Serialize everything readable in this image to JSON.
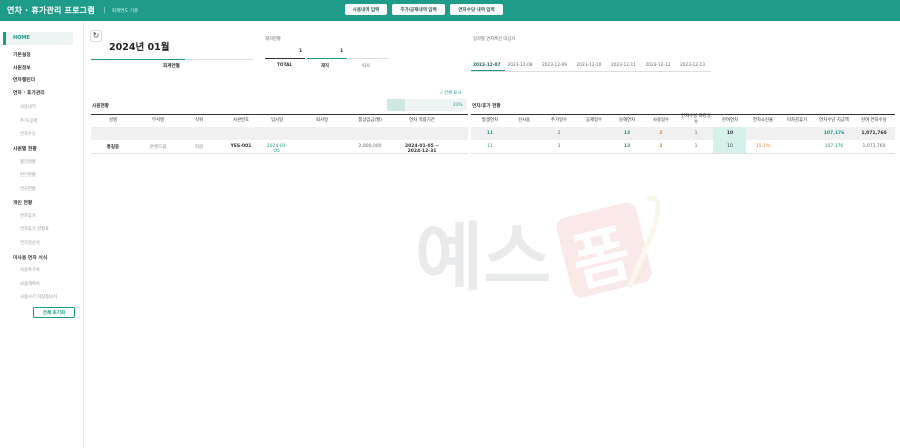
{
  "app": {
    "title": "연차 · 휴가관리 프로그램",
    "separator": "|",
    "subtitle": "회계연도 기준"
  },
  "top_buttons": [
    {
      "label": "사용내역 입력"
    },
    {
      "label": "추가/공제내역 입력"
    },
    {
      "label": "연차수당 내역 입력"
    }
  ],
  "sidebar": {
    "home": "HOME",
    "items": [
      {
        "label": "기본설정",
        "kind": "sec"
      },
      {
        "label": "사원정보",
        "kind": "sec"
      },
      {
        "label": "연차캘린더",
        "kind": "sec"
      },
      {
        "label": "연차 · 휴가관리",
        "kind": "sec"
      },
      {
        "label": "사용내역",
        "kind": "sub"
      },
      {
        "label": "추가/공제",
        "kind": "sub"
      },
      {
        "label": "연차수당",
        "kind": "sub"
      },
      {
        "label": "사원별 현황",
        "kind": "sec"
      },
      {
        "label": "월간현황",
        "kind": "sub"
      },
      {
        "label": "연간현황",
        "kind": "sub"
      },
      {
        "label": "연차현황",
        "kind": "sub"
      },
      {
        "label": "개인 현황",
        "kind": "sec"
      },
      {
        "label": "연차휴가",
        "kind": "sub"
      },
      {
        "label": "연차휴가 현황표",
        "kind": "sub"
      },
      {
        "label": "연차정산서",
        "kind": "sub"
      },
      {
        "label": "미사용 연차 서식",
        "kind": "sec"
      },
      {
        "label": "사용촉구서",
        "kind": "sub"
      },
      {
        "label": "사용계획서",
        "kind": "sub"
      },
      {
        "label": "사용시기 지정통보서",
        "kind": "sub"
      }
    ],
    "reset_button": "전체 초기화"
  },
  "header": {
    "month": "2024년 01월",
    "fiscal_label": "회계연월",
    "status_label": "재직현황",
    "status_values": {
      "total": "1",
      "active": "1"
    },
    "status_headers": {
      "total": "TOTAL",
      "active": "재직",
      "retired": "퇴사"
    },
    "promo_label": "일자별 연차촉진 대상자",
    "dates": [
      "2023-12-07",
      "2023-12-08",
      "2023-12-09",
      "2023-12-10",
      "2023-12-11",
      "2023-12-12",
      "2023-12-13"
    ]
  },
  "employees": {
    "section_label": "사원현황",
    "show_all": "√ 전체 표시",
    "progress_label": "23%",
    "progress_fraction": 0.23,
    "headers": [
      "성명",
      "부서명",
      "직위",
      "사원번호",
      "입사일",
      "퇴사일",
      "통상임금(월)",
      "연차 적용기간"
    ],
    "rows": [
      {
        "name": "홍길동",
        "dept": "온앤드림",
        "position": "직원",
        "emp_no": "YES-001",
        "join_date": "2024-01-05",
        "leave_date": "",
        "wage": "2,800,000",
        "period": "2024-01-05 ~ 2024-12-31"
      }
    ]
  },
  "leave": {
    "section_label": "연차/휴가 현황",
    "headers": [
      "발생연차",
      "선사용",
      "추가일수",
      "공제일수",
      "당해연차",
      "사용일수",
      "연차수당 차감일수",
      "잔여연차",
      "연차소진율",
      "미차감휴가",
      "연차수당 지급액",
      "잔여 연차수당"
    ],
    "summary": {
      "issued": "11",
      "pre_used": "",
      "added": "2",
      "deducted": "",
      "current": "13",
      "used": "2",
      "deduct_days": "1",
      "remain": "10",
      "rate": "",
      "undeducted": "",
      "allowance_paid": "107,176",
      "remaining_allowance": "1,071,760"
    },
    "rows": [
      {
        "issued": "11",
        "pre_used": "",
        "added": "2",
        "deducted": "",
        "current": "13",
        "used": "2",
        "deduct_days": "1",
        "remain": "10",
        "rate": "15.1%",
        "undeducted": "",
        "allowance_paid": "107,176",
        "remaining_allowance": "1,071,760"
      }
    ]
  },
  "watermark": {
    "text": "예스폼"
  },
  "colors": {
    "brand": "#1f9b8a",
    "accent": "#e67e22",
    "highlight": "#d6f0ec"
  }
}
